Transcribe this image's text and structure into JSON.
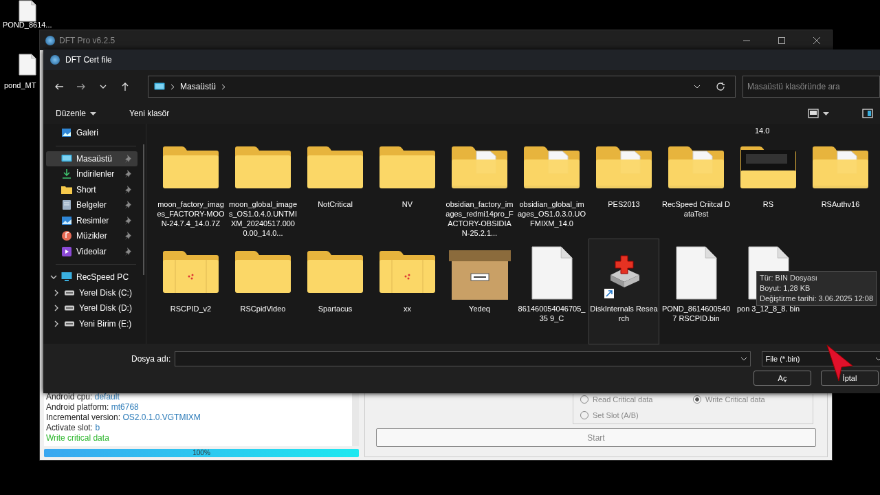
{
  "desktop_icons": [
    {
      "label": "POND_8614..."
    },
    {
      "label": "pond_MT"
    }
  ],
  "app_window": {
    "title": "DFT Pro v6.2.5",
    "log": [
      {
        "label": "Android cpu: ",
        "value": "default",
        "kind": "pair"
      },
      {
        "label": "Android platform: ",
        "value": "mt6768",
        "kind": "pair"
      },
      {
        "label": "Incremental version: ",
        "value": "OS2.0.1.0.VGTMIXM",
        "kind": "pair"
      },
      {
        "label": "Activate slot: ",
        "value": "b",
        "kind": "pair"
      },
      {
        "label": "Write critical data",
        "kind": "success"
      }
    ],
    "progress": {
      "level": 1,
      "reading": "100%"
    },
    "options": [
      {
        "label": "Read Critical data",
        "selected": false
      },
      {
        "label": "Write Critical data",
        "selected": true
      },
      {
        "label": "Set Slot (A/B)",
        "selected": false
      }
    ],
    "start_button": "Start"
  },
  "dialog": {
    "title": "DFT Cert file",
    "breadcrumb": "Masaüstü",
    "search": {
      "placeholder": "Masaüstü klasöründe ara"
    },
    "commands": [
      "Düzenle",
      "Yeni klasör"
    ],
    "sidebar": [
      {
        "label": "Galeri",
        "kind": "gallery",
        "selected": false,
        "pinned": false
      },
      {
        "kind": "divider"
      },
      {
        "label": "Masaüstü",
        "kind": "desktop",
        "selected": true,
        "pinned": true
      },
      {
        "label": "İndirilenler",
        "kind": "download",
        "selected": false,
        "pinned": true
      },
      {
        "label": "Short",
        "kind": "folder",
        "selected": false,
        "pinned": true
      },
      {
        "label": "Belgeler",
        "kind": "documents",
        "selected": false,
        "pinned": true
      },
      {
        "label": "Resimler",
        "kind": "pictures",
        "selected": false,
        "pinned": true
      },
      {
        "label": "Müzikler",
        "kind": "music",
        "selected": false,
        "pinned": true
      },
      {
        "label": "Videolar",
        "kind": "videos",
        "selected": false,
        "pinned": true
      },
      {
        "kind": "divider"
      },
      {
        "label": "RecSpeed PC",
        "kind": "pc",
        "selected": false,
        "pinned": false,
        "expanded": true,
        "children": [
          {
            "label": "Yerel Disk (C:)",
            "kind": "drive",
            "selected": false,
            "expanded": false
          },
          {
            "label": "Yerel Disk (D:)",
            "kind": "drive",
            "selected": false,
            "expanded": false
          },
          {
            "label": "Yeni Birim (E:)",
            "kind": "drive",
            "selected": false,
            "expanded": false
          }
        ]
      }
    ],
    "partial_row_text": "14.0",
    "files": [
      {
        "name": "moon_factory_images_FACTORY-MOON-24.7.4_14.0.7Z",
        "kind": "folder"
      },
      {
        "name": "moon_global_images_OS1.0.4.0.UNTMIXM_20240517.0000.00_14.0...",
        "kind": "folder"
      },
      {
        "name": "NotCritical",
        "kind": "folder"
      },
      {
        "name": "NV",
        "kind": "folder"
      },
      {
        "name": "obsidian_factory_images_redmi14pro_FACTORY-OBSIDIAN-25.2.1...",
        "kind": "folder-docs"
      },
      {
        "name": "obsidian_global_images_OS1.0.3.0.UOFMIXM_14.0",
        "kind": "folder-docs"
      },
      {
        "name": "PES2013",
        "kind": "folder-docs"
      },
      {
        "name": "RecSpeed Criitcal DataTest",
        "kind": "folder-docs"
      },
      {
        "name": "RS",
        "kind": "folder-screen"
      },
      {
        "name": "RSAuthv16",
        "kind": "folder-docs"
      },
      {
        "name": "RSCPID_v2",
        "kind": "folder-open"
      },
      {
        "name": "RSCpidVideo",
        "kind": "folder"
      },
      {
        "name": "Spartacus",
        "kind": "folder"
      },
      {
        "name": "xx",
        "kind": "folder-open"
      },
      {
        "name": "Yedeq",
        "kind": "archive"
      },
      {
        "name": "861460054046705_35 9_C",
        "kind": "file"
      },
      {
        "name": "DiskInternals Research",
        "kind": "shortcut",
        "selected": true
      },
      {
        "name": "POND_8614600540 7 RSCPID.bin",
        "kind": "file"
      },
      {
        "name": "pon 3_12_8_8. bin",
        "kind": "file"
      }
    ],
    "tooltip": [
      "Tür: BIN Dosyası",
      "Boyut: 1,28 KB",
      "Değiştirme tarihi: 3.06.2025 12:08"
    ],
    "filename_label": "Dosya adı:",
    "filter": "File (*.bin)",
    "buttons": [
      "Aç",
      "İptal"
    ]
  }
}
